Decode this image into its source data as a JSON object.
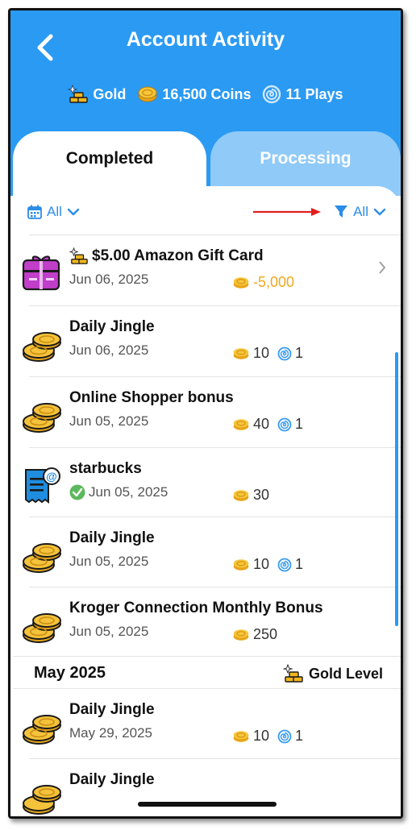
{
  "header": {
    "title": "Account Activity",
    "stats": {
      "level": "Gold",
      "coins": "16,500 Coins",
      "plays": "11 Plays"
    }
  },
  "tabs": [
    {
      "label": "Completed",
      "active": true
    },
    {
      "label": "Processing",
      "active": false
    }
  ],
  "filters": {
    "date_filter": "All",
    "type_filter": "All"
  },
  "transactions": [
    {
      "name": "$5.00 Amazon Gift Card",
      "date": "Jun 06, 2025",
      "coins": "-5,000",
      "plays": "",
      "icon": "gift-card-icon",
      "has_chevron": true
    },
    {
      "name": "Daily Jingle",
      "date": "Jun 06, 2025",
      "coins": "10",
      "plays": "1",
      "icon": "coins-icon"
    },
    {
      "name": "Online Shopper bonus",
      "date": "Jun 05, 2025",
      "coins": "40",
      "plays": "1",
      "icon": "coins-icon"
    },
    {
      "name": "starbucks",
      "date": "Jun 05, 2025",
      "coins": "30",
      "plays": "",
      "icon": "receipt-icon",
      "verified": true
    },
    {
      "name": "Daily Jingle",
      "date": "Jun 05, 2025",
      "coins": "10",
      "plays": "1",
      "icon": "coins-icon"
    },
    {
      "name": "Kroger Connection Monthly Bonus",
      "date": "Jun 05, 2025",
      "coins": "250",
      "plays": "",
      "icon": "coins-icon"
    }
  ],
  "section": {
    "title": "May 2025",
    "level": "Gold Level"
  },
  "may_transactions": [
    {
      "name": "Daily Jingle",
      "date": "May 29, 2025",
      "coins": "10",
      "plays": "1",
      "icon": "coins-icon"
    },
    {
      "name": "Daily Jingle",
      "date": "",
      "coins": "",
      "plays": "",
      "icon": "coins-icon"
    }
  ],
  "colors": {
    "header_blue": "#2b9af3",
    "tab_inactive": "#8fcaf8",
    "link_blue": "#2b8de8",
    "negative_coins": "#f2a81d"
  }
}
